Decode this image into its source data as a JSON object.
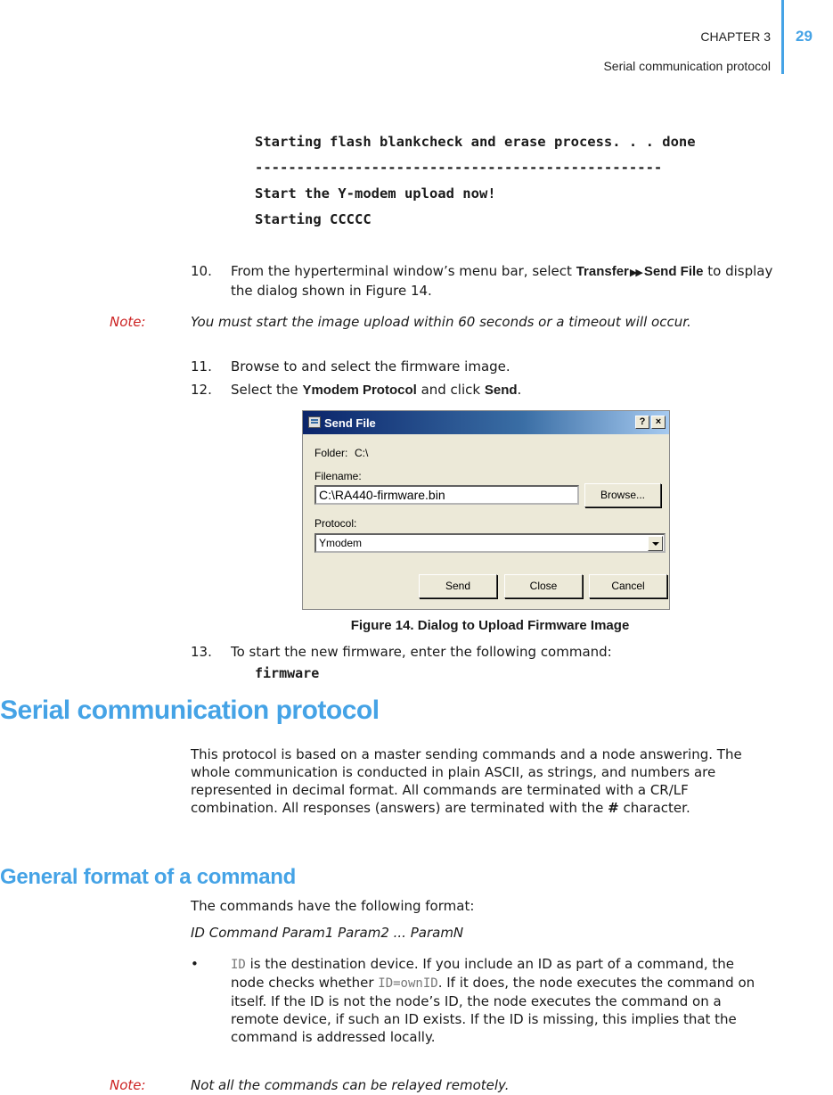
{
  "header": {
    "chapter": "CHAPTER 3",
    "section": "Serial communication protocol",
    "page_number": "29",
    "accent_color": "#45a3e6"
  },
  "code_block": [
    "Starting flash blankcheck and erase process. . . done",
    "-------------------------------------------------",
    "Start the Y-modem upload now!",
    "Starting CCCCC"
  ],
  "steps": {
    "s10": {
      "number": "10.",
      "pre": "From the hyperterminal window’s menu bar, select ",
      "menu1": "Transfer",
      "menu2": "Send File",
      "post": " to display the dialog shown in Figure 14."
    },
    "s11": {
      "number": "11.",
      "text": "Browse to and select the firmware image."
    },
    "s12": {
      "number": "12.",
      "pre": "Select the ",
      "ui1": "Ymodem Protocol",
      "mid": " and click ",
      "ui2": "Send",
      "post": "."
    },
    "s13": {
      "number": "13.",
      "text": "To start the new firmware, enter the following command:",
      "command": "firmware"
    }
  },
  "notes": {
    "label": "Note:",
    "timeout": "You must start the image upload within 60 seconds or a timeout will occur.",
    "relay": "Not all the commands can be relayed remotely."
  },
  "dialog": {
    "title": "Send File",
    "help_button": "?",
    "close_button": "×",
    "folder_label": "Folder:",
    "folder_value": "C:\\",
    "filename_label": "Filename:",
    "filename_value": "C:\\RA440-firmware.bin",
    "browse_button": "Browse...",
    "protocol_label": "Protocol:",
    "protocol_value": "Ymodem",
    "send_button": "Send",
    "close_label": "Close",
    "cancel_button": "Cancel"
  },
  "figure_caption": "Figure 14.  Dialog to Upload Firmware Image",
  "section": {
    "heading": "Serial communication protocol",
    "paragraph_pre": "This protocol is based on a master sending commands and a node answering. The whole communication is conducted in plain ASCII, as strings, and numbers are represented in decimal format. All commands are terminated with a CR/LF combination. All responses (answers) are terminated with the ",
    "paragraph_symbol": "#",
    "paragraph_post": " character."
  },
  "subsection": {
    "heading": "General format of a command",
    "intro": "The commands have the following format:",
    "format": "ID Command Param1 Param2 ... ParamN",
    "bullet": {
      "marker": "•",
      "code1": "ID",
      "t1": " is the destination device. If you include an ID as part of a command, the node checks whether ",
      "code2": "ID=ownID",
      "t2": ". If it does, the node executes the command on itself. If the ID is not the node’s ID, the node executes the command on a remote device, if such an ID exists. If the ID is missing, this implies that the command is addressed locally."
    }
  }
}
